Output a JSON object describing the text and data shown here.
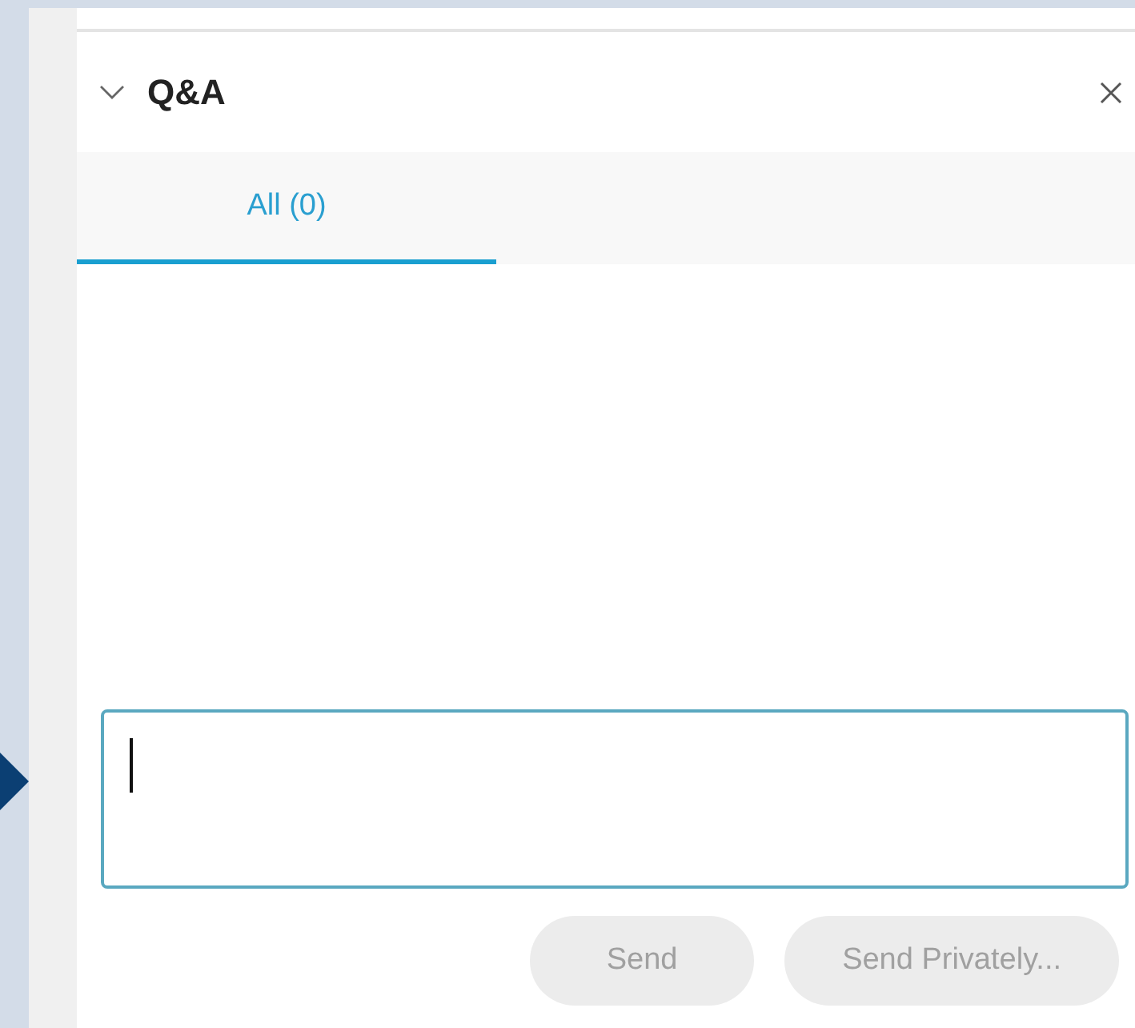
{
  "panel": {
    "title": "Q&A",
    "expanded": true
  },
  "tabs": [
    {
      "label": "All (0)",
      "selected": true
    }
  ],
  "buttons": [
    {
      "label": "Send",
      "disabled": true
    },
    {
      "label": "Send Privately...",
      "disabled": true
    }
  ]
}
